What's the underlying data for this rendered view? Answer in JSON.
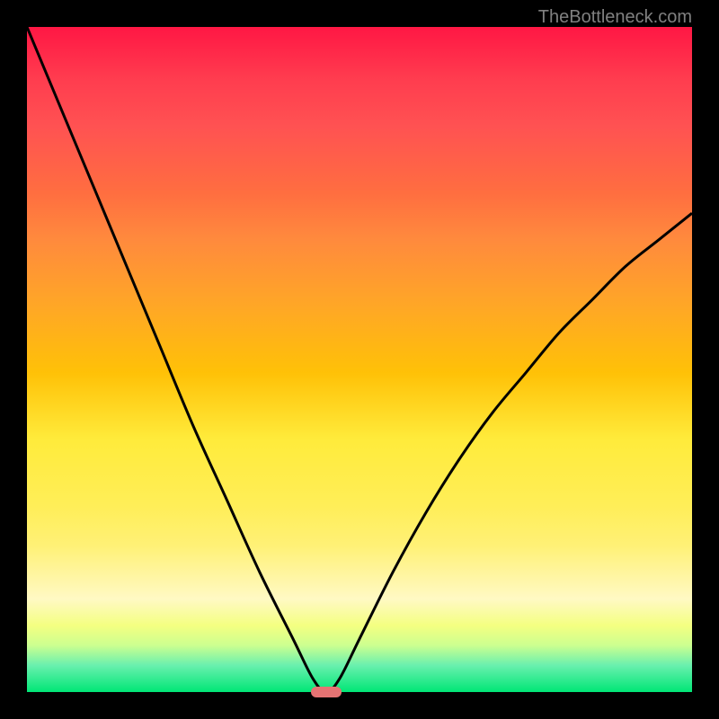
{
  "watermark": "TheBottleneck.com",
  "chart_data": {
    "type": "line",
    "title": "",
    "xlabel": "",
    "ylabel": "",
    "xlim": [
      0,
      100
    ],
    "ylim": [
      0,
      100
    ],
    "series": [
      {
        "name": "bottleneck-curve",
        "x": [
          0,
          5,
          10,
          15,
          20,
          25,
          30,
          35,
          40,
          43,
          45,
          47,
          50,
          55,
          60,
          65,
          70,
          75,
          80,
          85,
          90,
          95,
          100
        ],
        "values": [
          100,
          88,
          76,
          64,
          52,
          40,
          29,
          18,
          8,
          2,
          0,
          2,
          8,
          18,
          27,
          35,
          42,
          48,
          54,
          59,
          64,
          68,
          72
        ]
      }
    ],
    "marker": {
      "x": 45,
      "y": 0,
      "color": "#e57373"
    },
    "gradient_stops": [
      {
        "pos": 0,
        "color": "#ff1744"
      },
      {
        "pos": 50,
        "color": "#ffc107"
      },
      {
        "pos": 80,
        "color": "#fff176"
      },
      {
        "pos": 100,
        "color": "#00e676"
      }
    ]
  }
}
